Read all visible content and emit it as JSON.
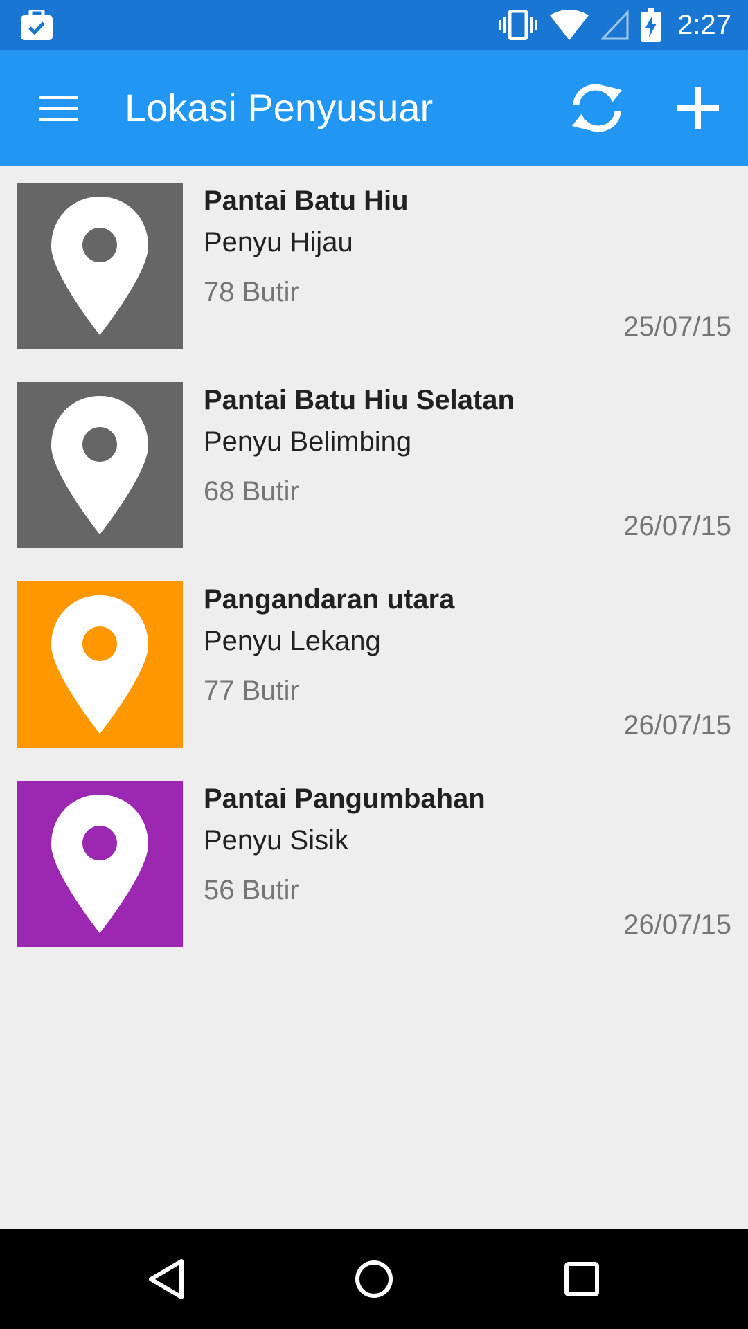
{
  "status_bar": {
    "time": "2:27",
    "left_icon": "briefcase-check-icon",
    "icons": [
      "vibrate-icon",
      "wifi-icon",
      "cell-signal-icon",
      "battery-charging-icon"
    ],
    "background": "#1976d2"
  },
  "app_bar": {
    "title": "Lokasi Penyusuar",
    "background": "#2196f3",
    "menu_icon": "hamburger-menu-icon",
    "actions": [
      "refresh-icon",
      "add-icon"
    ]
  },
  "locations": [
    {
      "title": "Pantai Batu Hiu",
      "species": "Penyu Hijau",
      "count": "78 Butir",
      "date": "25/07/15",
      "color": "#666666",
      "icon": "map-pin-icon"
    },
    {
      "title": "Pantai Batu Hiu Selatan",
      "species": "Penyu Belimbing",
      "count": "68 Butir",
      "date": "26/07/15",
      "color": "#666666",
      "icon": "map-pin-icon"
    },
    {
      "title": "Pangandaran utara",
      "species": "Penyu Lekang",
      "count": "77 Butir",
      "date": "26/07/15",
      "color": "#ff9800",
      "icon": "map-pin-icon"
    },
    {
      "title": "Pantai Pangumbahan",
      "species": "Penyu Sisik",
      "count": "56 Butir",
      "date": "26/07/15",
      "color": "#9c27b0",
      "icon": "map-pin-icon"
    }
  ],
  "nav_bar": {
    "buttons": [
      "back-icon",
      "home-icon",
      "recents-icon"
    ]
  }
}
